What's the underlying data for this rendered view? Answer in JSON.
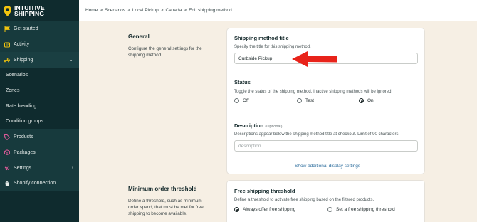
{
  "app": {
    "brand": [
      "INTUITIVE",
      "SHIPPING"
    ],
    "accent": "#f1c40f"
  },
  "sidebar": {
    "items": [
      {
        "label": "Get started",
        "icon": "flag-icon",
        "level": "top"
      },
      {
        "label": "Activity",
        "icon": "activity-icon",
        "level": "top"
      },
      {
        "label": "Shipping",
        "icon": "truck-icon",
        "level": "top",
        "expanded": true
      },
      {
        "label": "Scenarios",
        "level": "sub"
      },
      {
        "label": "Zones",
        "level": "sub"
      },
      {
        "label": "Rate blending",
        "level": "sub"
      },
      {
        "label": "Condition groups",
        "level": "sub"
      },
      {
        "label": "Products",
        "icon": "tag-icon",
        "level": "top"
      },
      {
        "label": "Packages",
        "icon": "package-icon",
        "level": "top"
      },
      {
        "label": "Settings",
        "icon": "gear-icon",
        "level": "top",
        "chevron": "right"
      },
      {
        "label": "Shopify connection",
        "icon": "shopify-icon",
        "level": "top"
      }
    ]
  },
  "breadcrumb": [
    "Home",
    "Scenarios",
    "Local Pickup",
    "Canada",
    "Edit shipping method"
  ],
  "general": {
    "title": "General",
    "description": "Configure the general settings for the shipping method."
  },
  "method_title": {
    "heading": "Shipping method title",
    "help": "Specify the title for this shipping method.",
    "value": "Curbside Pickup"
  },
  "status": {
    "heading": "Status",
    "help": "Toggle the status of the shipping method. Inactive shipping methods will be ignored.",
    "options": [
      "Off",
      "Test",
      "On"
    ],
    "selected": "On"
  },
  "description": {
    "heading": "Description",
    "optional": "(Optional)",
    "help": "Descriptions appear below the shipping method title at checkout. Limit of 90 characters.",
    "placeholder": "description",
    "link": "Show additional display settings"
  },
  "min_order": {
    "title": "Minimum order threshold",
    "description": "Define a threshold, such as minimum order spend, that must be met for free shipping to become available."
  },
  "free_shipping": {
    "heading": "Free shipping threshold",
    "help": "Define a threshold to activate free shipping based on the filtered products.",
    "options": [
      "Always offer free shipping",
      "Set a free shipping threshold"
    ],
    "selected": "Always offer free shipping"
  },
  "annotation": {
    "arrow_color": "#e8231a"
  }
}
